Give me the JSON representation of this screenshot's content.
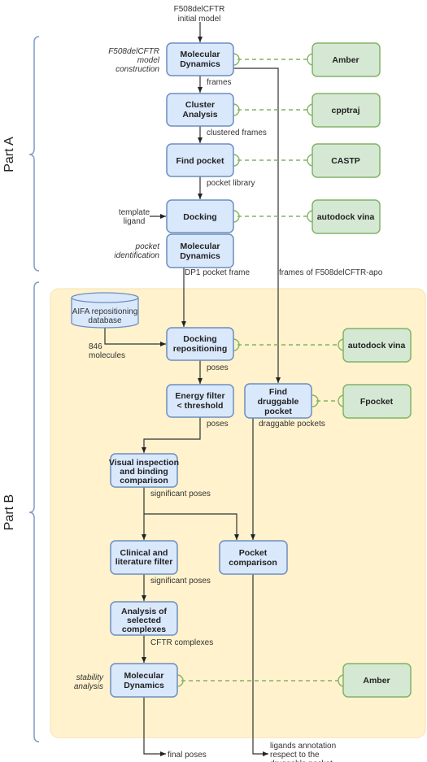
{
  "diagram": {
    "parts": [
      {
        "id": "part-a",
        "label": "Part A"
      },
      {
        "id": "part-b",
        "label": "Part B"
      }
    ],
    "top_input": [
      "F508delCFTR",
      "initial model"
    ],
    "side_labels": {
      "model_construction": [
        "F508delCFTR",
        "model",
        "construction"
      ],
      "pocket_identification": [
        "pocket",
        "identification"
      ],
      "stability_analysis": [
        "stability",
        "analysis"
      ],
      "template_ligand": [
        "template",
        "ligand"
      ],
      "molecules": [
        "846",
        "molecules"
      ]
    },
    "process_nodes": {
      "md1": [
        "Molecular",
        "Dynamics"
      ],
      "cluster": [
        "Cluster",
        "Analysis"
      ],
      "find_pocket": [
        "Find pocket"
      ],
      "docking": [
        "Docking"
      ],
      "md2": [
        "Molecular",
        "Dynamics"
      ],
      "docking_repo": [
        "Docking",
        "repositioning"
      ],
      "energy": [
        "Energy filter",
        "< threshold"
      ],
      "find_druggable": [
        "Find",
        "druggable",
        "pocket"
      ],
      "visual": [
        "Visual inspection",
        "and binding",
        "comparison"
      ],
      "clinical": [
        "Clinical and",
        "literature filter"
      ],
      "pocket_comp": [
        "Pocket",
        "comparison"
      ],
      "analysis": [
        "Analysis of",
        "selected",
        "complexes"
      ],
      "md3": [
        "Molecular",
        "Dynamics"
      ]
    },
    "tool_nodes": {
      "amber1": "Amber",
      "cpptraj": "cpptraj",
      "castp": "CASTP",
      "vina1": "autodock vina",
      "vina2": "autodock vina",
      "fpocket": "Fpocket",
      "amber2": "Amber"
    },
    "database": [
      "AIFA repositioning",
      "database"
    ],
    "edge_labels": {
      "frames": "frames",
      "clustered_frames": "clustered frames",
      "pocket_library": "pocket library",
      "dp1_pocket_frame": "DP1 pocket frame",
      "frames_apo": "frames of F508delCFTR-apo",
      "poses1": "poses",
      "poses2": "poses",
      "draggable_pockets": "draggable pockets",
      "significant_poses1": "significant poses",
      "significant_poses2": "significant poses",
      "cftr_complexes": "CFTR complexes"
    },
    "outputs": {
      "final_poses": "final poses",
      "ligands_annotation": [
        "ligands annotation",
        "respect to the",
        "druggable pocket"
      ]
    },
    "colors": {
      "process_fill": "#dae8fc",
      "process_stroke": "#6c8ebf",
      "tool_fill": "#d5e8d4",
      "tool_stroke": "#82b366",
      "part_b_background": "#fff2cc",
      "brace": "#7e9cc8"
    }
  }
}
